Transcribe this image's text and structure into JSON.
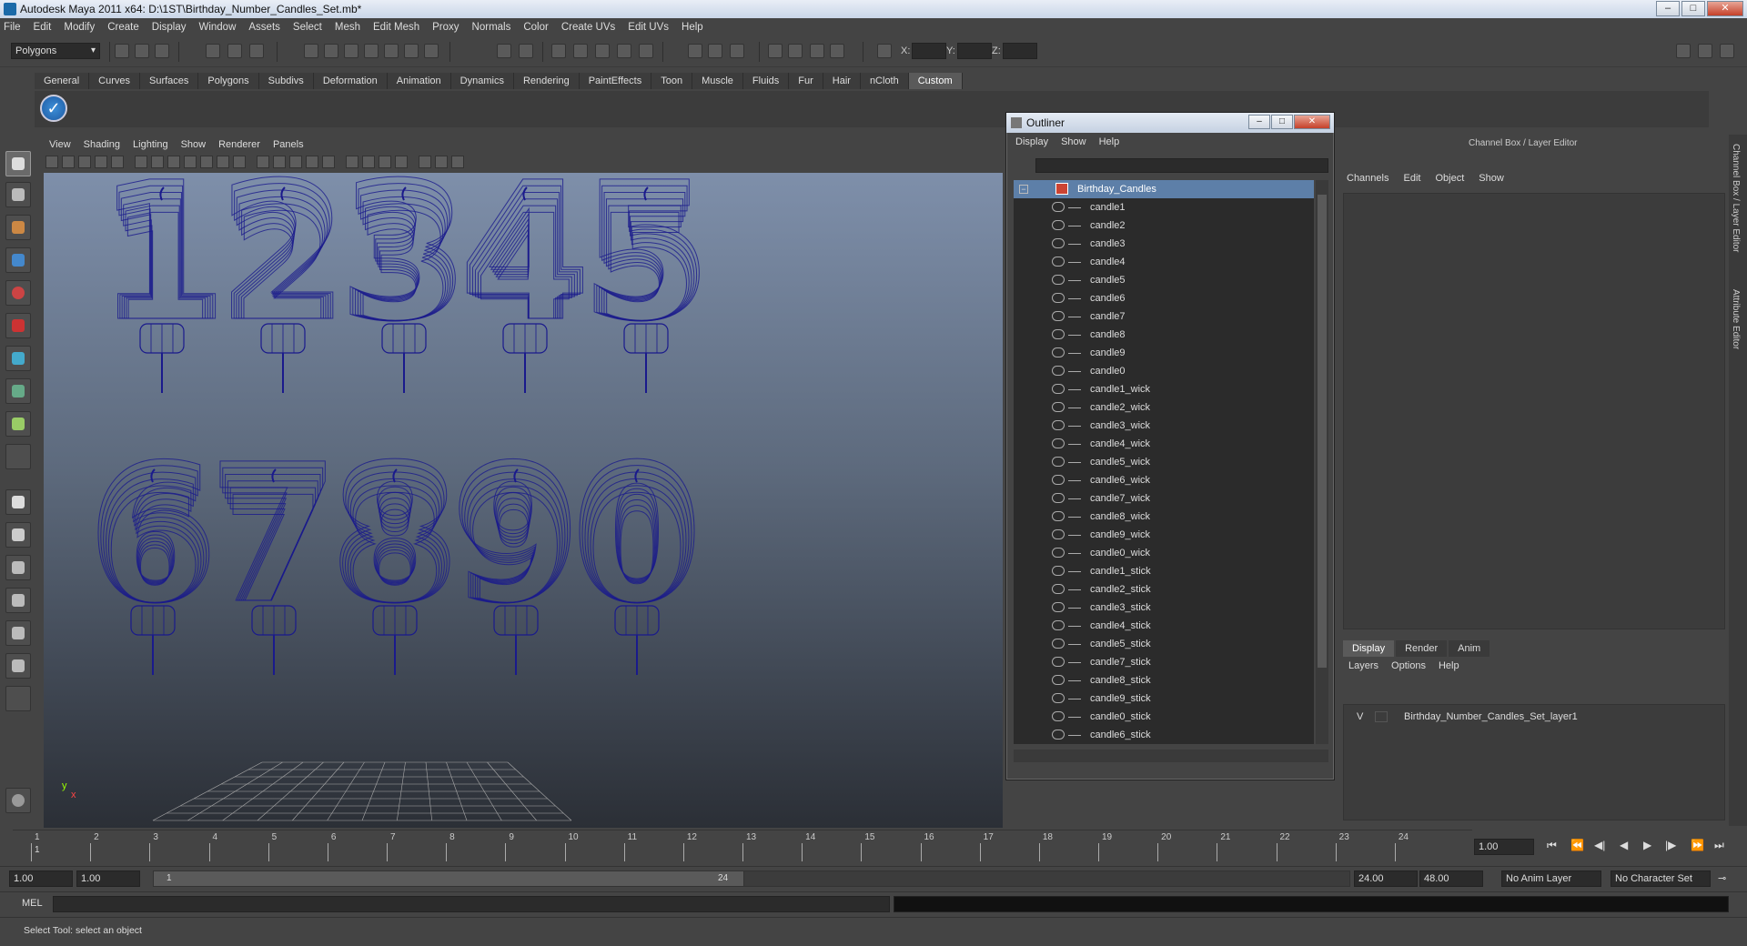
{
  "window": {
    "title": "Autodesk Maya 2011 x64: D:\\1ST\\Birthday_Number_Candles_Set.mb*",
    "minimize": "–",
    "maximize": "□",
    "close": "✕"
  },
  "menubar": [
    "File",
    "Edit",
    "Modify",
    "Create",
    "Display",
    "Window",
    "Assets",
    "Select",
    "Mesh",
    "Edit Mesh",
    "Proxy",
    "Normals",
    "Color",
    "Create UVs",
    "Edit UVs",
    "Help"
  ],
  "toolbar": {
    "mode": "Polygons",
    "x_label": "X:",
    "y_label": "Y:",
    "z_label": "Z:"
  },
  "shelf": {
    "tabs": [
      "General",
      "Curves",
      "Surfaces",
      "Polygons",
      "Subdivs",
      "Deformation",
      "Animation",
      "Dynamics",
      "Rendering",
      "PaintEffects",
      "Toon",
      "Muscle",
      "Fluids",
      "Fur",
      "Hair",
      "nCloth",
      "Custom"
    ],
    "active_tab": "Custom"
  },
  "viewport": {
    "menu": [
      "View",
      "Shading",
      "Lighting",
      "Show",
      "Renderer",
      "Panels"
    ],
    "axis_y": "y",
    "axis_x": "x",
    "candles": [
      "1",
      "2",
      "3",
      "4",
      "5",
      "6",
      "7",
      "8",
      "9",
      "0"
    ],
    "wire_color": "#1a1a8c"
  },
  "outliner": {
    "title": "Outliner",
    "menu": [
      "Display",
      "Show",
      "Help"
    ],
    "root": "Birthday_Candles",
    "items": [
      "candle1",
      "candle2",
      "candle3",
      "candle4",
      "candle5",
      "candle6",
      "candle7",
      "candle8",
      "candle9",
      "candle0",
      "candle1_wick",
      "candle2_wick",
      "candle3_wick",
      "candle4_wick",
      "candle5_wick",
      "candle6_wick",
      "candle7_wick",
      "candle8_wick",
      "candle9_wick",
      "candle0_wick",
      "candle1_stick",
      "candle2_stick",
      "candle3_stick",
      "candle4_stick",
      "candle5_stick",
      "candle7_stick",
      "candle8_stick",
      "candle9_stick",
      "candle0_stick",
      "candle6_stick"
    ]
  },
  "channel_box": {
    "title": "Channel Box / Layer Editor",
    "menu": [
      "Channels",
      "Edit",
      "Object",
      "Show"
    ],
    "layer_tabs": [
      "Display",
      "Render",
      "Anim"
    ],
    "active_layer_tab": "Display",
    "layer_menu": [
      "Layers",
      "Options",
      "Help"
    ],
    "layer": {
      "visible": "V",
      "name": "Birthday_Number_Candles_Set_layer1"
    }
  },
  "side_tabs": [
    "Channel Box / Layer Editor",
    "Attribute Editor"
  ],
  "timeline": {
    "ticks": [
      "1",
      "2",
      "3",
      "4",
      "5",
      "6",
      "7",
      "8",
      "9",
      "10",
      "11",
      "12",
      "13",
      "14",
      "15",
      "16",
      "17",
      "18",
      "19",
      "20",
      "21",
      "22",
      "23",
      "24"
    ],
    "current_frame": "1",
    "current_time": "1.00"
  },
  "range": {
    "start": "1.00",
    "start2": "1.00",
    "slider_start": "1",
    "slider_end": "24",
    "end": "24.00",
    "end2": "48.00",
    "anim_layer": "No Anim Layer",
    "char_set": "No Character Set"
  },
  "cmdline": {
    "label": "MEL"
  },
  "helpline": {
    "text": "Select Tool: select an object"
  }
}
